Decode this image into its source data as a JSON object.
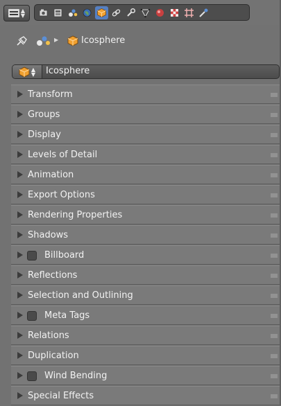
{
  "header": {
    "editor_type_icon": "properties-editor-icon",
    "tabs": [
      {
        "icon": "render-icon",
        "active": false
      },
      {
        "icon": "render-layers-icon",
        "active": false
      },
      {
        "icon": "scene-icon",
        "active": false
      },
      {
        "icon": "world-icon",
        "active": false
      },
      {
        "icon": "object-icon",
        "active": true
      },
      {
        "icon": "constraints-icon",
        "active": false
      },
      {
        "icon": "modifiers-icon",
        "active": false
      },
      {
        "icon": "data-icon",
        "active": false
      },
      {
        "icon": "material-icon",
        "active": false
      },
      {
        "icon": "texture-icon",
        "active": false
      },
      {
        "icon": "particles-icon",
        "active": false
      },
      {
        "icon": "physics-icon",
        "active": false
      }
    ]
  },
  "context": {
    "path_label": "Icosphere"
  },
  "object_field": {
    "name": "Icosphere"
  },
  "panels": [
    {
      "label": "Transform",
      "checkbox": false
    },
    {
      "label": "Groups",
      "checkbox": false
    },
    {
      "label": "Display",
      "checkbox": false
    },
    {
      "label": "Levels of Detail",
      "checkbox": false
    },
    {
      "label": "Animation",
      "checkbox": false
    },
    {
      "label": "Export Options",
      "checkbox": false
    },
    {
      "label": "Rendering Properties",
      "checkbox": false
    },
    {
      "label": "Shadows",
      "checkbox": false
    },
    {
      "label": "Billboard",
      "checkbox": true
    },
    {
      "label": "Reflections",
      "checkbox": false
    },
    {
      "label": "Selection and Outlining",
      "checkbox": false
    },
    {
      "label": "Meta Tags",
      "checkbox": true
    },
    {
      "label": "Relations",
      "checkbox": false
    },
    {
      "label": "Duplication",
      "checkbox": false
    },
    {
      "label": "Wind Bending",
      "checkbox": true
    },
    {
      "label": "Special Effects",
      "checkbox": false
    }
  ],
  "colors": {
    "active_tab": "#5680c2",
    "panel_bg": "#7a7a7a",
    "object_orange": "#f0a030"
  }
}
